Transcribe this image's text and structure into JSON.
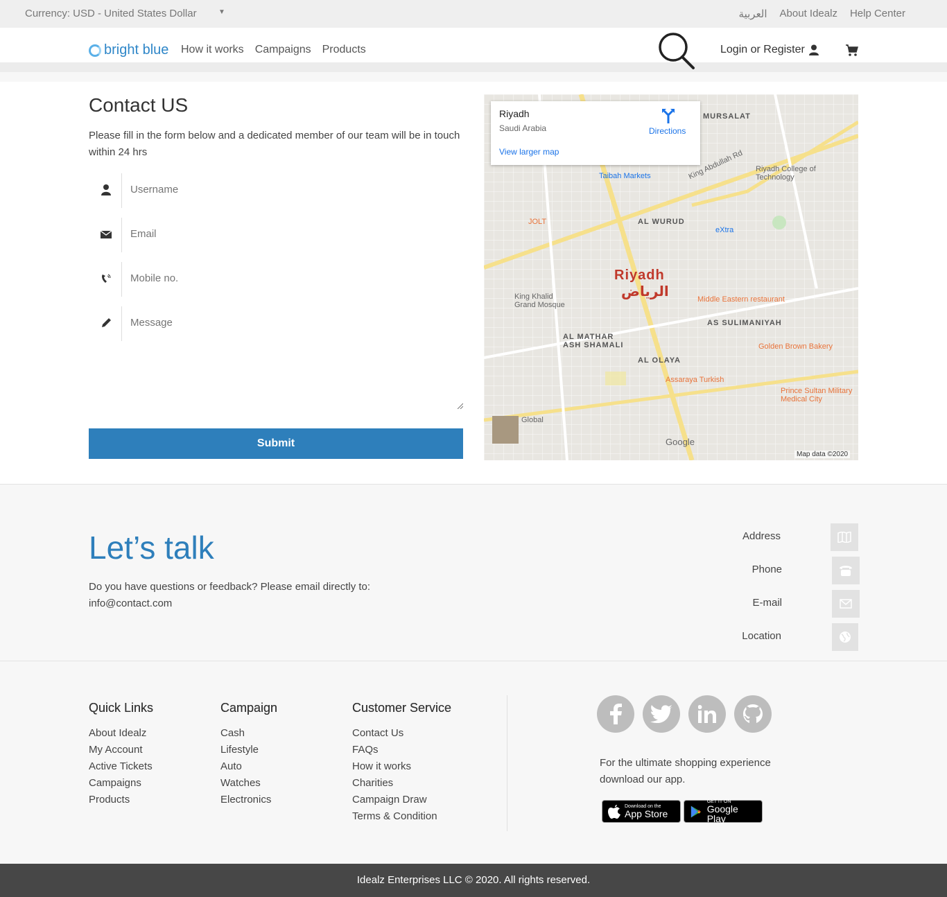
{
  "topbar": {
    "currency": "Currency: USD - United States Dollar",
    "arabic": "العربية",
    "about": "About Idealz",
    "help": "Help Center"
  },
  "nav": {
    "logo": "bright blue",
    "links": [
      "How it works",
      "Campaigns",
      "Products"
    ],
    "login": "Login or Register"
  },
  "contact": {
    "title": "Contact US",
    "intro": "Please fill in the form below and a dedicated member of our team will be in touch within 24 hrs",
    "username_placeholder": "Username",
    "email_placeholder": "Email",
    "mobile_placeholder": "Mobile no.",
    "message_placeholder": "Message",
    "submit": "Submit"
  },
  "map": {
    "place": "Riyadh",
    "country": "Saudi Arabia",
    "directions": "Directions",
    "larger": "View larger map",
    "city_en": "Riyadh",
    "city_ar": "الرياض",
    "labels": [
      "MURSALAT",
      "Taibah Markets",
      "AL WURUD",
      "eXtra",
      "Riyadh College of Technology",
      "JOLT",
      "King Khalid Grand Mosque",
      "AL MATHAR ASH SHAMALI",
      "AS SULIMANIYAH",
      "Golden Brown Bakery",
      "AL OLAYA",
      "Assaraya Turkish",
      "Prince Sultan Military Medical City",
      "Global",
      "Middle Eastern restaurant",
      "King Abdullah Rd"
    ],
    "attribution": "Map data ©2020",
    "google": "Google"
  },
  "talk": {
    "title": "Let’s talk",
    "desc": "Do you have questions or feedback? Please email directly to:",
    "email": "info@contact.com",
    "rows": [
      "Address",
      "Phone",
      "E-mail",
      "Location"
    ]
  },
  "footer": {
    "quick": {
      "title": "Quick Links",
      "items": [
        "About Idealz",
        "My Account",
        "Active Tickets",
        "Campaigns",
        "Products"
      ]
    },
    "campaign": {
      "title": "Campaign",
      "items": [
        "Cash",
        "Lifestyle",
        "Auto",
        "Watches",
        "Electronics"
      ]
    },
    "service": {
      "title": "Customer Service",
      "items": [
        "Contact Us",
        "FAQs",
        "How it works",
        "Charities",
        "Campaign Draw",
        "Terms & Condition"
      ]
    },
    "shop_text": "For the ultimate shopping experience download our app.",
    "appstore_small": "Download on the",
    "appstore_big": "App Store",
    "google_small": "GET IT ON",
    "google_big": "Google Play",
    "copyright": "Idealz Enterprises LLC © 2020. All rights reserved."
  }
}
